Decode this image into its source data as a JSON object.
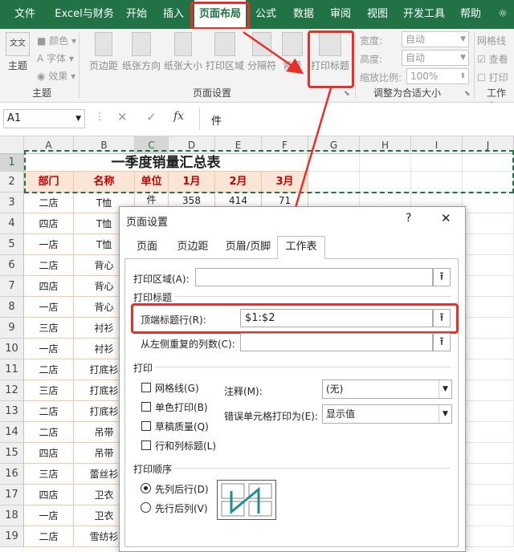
{
  "tabs": [
    "文件",
    "Excel与财务",
    "开始",
    "插入",
    "页面布局",
    "公式",
    "数据",
    "审阅",
    "视图",
    "开发工具",
    "帮助"
  ],
  "ribbon": {
    "theme_group": {
      "label": "主题",
      "themes": "主题",
      "colors": "颜色",
      "fonts": "字体",
      "effects": "效果"
    },
    "page_setup_group": {
      "label": "页面设置",
      "margins": "页边距",
      "orientation": "纸张方向",
      "size": "纸张大小",
      "print_area": "打印区域",
      "breaks": "分隔符",
      "background": "背景",
      "print_titles": "打印标题"
    },
    "scale_group": {
      "label": "调整为合适大小",
      "width_label": "宽度:",
      "width_value": "自动",
      "height_label": "高度:",
      "height_value": "自动",
      "scale_label": "缩放比例:",
      "scale_value": "100%"
    },
    "sheet_options_group": {
      "label": "工作表",
      "gridlines": "网格线",
      "view": "查看",
      "print": "打印"
    }
  },
  "formula_bar": {
    "name_box": "A1",
    "fx": "fx",
    "content": "件"
  },
  "columns": [
    "A",
    "B",
    "C",
    "D",
    "E",
    "F",
    "G",
    "H",
    "I",
    "J"
  ],
  "rows": [
    "1",
    "2",
    "3",
    "4",
    "5",
    "6",
    "7",
    "8",
    "9",
    "10",
    "11",
    "12",
    "13",
    "14",
    "15",
    "16",
    "17",
    "18",
    "19"
  ],
  "sheet": {
    "title": "一季度销量汇总表",
    "headers": [
      "部门",
      "名称",
      "单位",
      "1月",
      "2月",
      "3月"
    ],
    "row3_values": [
      "358",
      "414",
      "71"
    ],
    "dept": [
      "二店",
      "四店",
      "一店",
      "二店",
      "四店",
      "一店",
      "三店",
      "一店",
      "二店",
      "三店",
      "二店",
      "二店",
      "四店",
      "三店",
      "四店",
      "一店",
      "二店"
    ],
    "names": [
      "T恤",
      "T恤",
      "T恤",
      "背心",
      "背心",
      "背心",
      "衬衫",
      "衬衫",
      "打底衫",
      "打底衫",
      "打底衫",
      "吊带",
      "吊带",
      "蕾丝衫",
      "卫衣",
      "卫衣",
      "雪纺衫"
    ],
    "unit_first": "件"
  },
  "dialog": {
    "title": "页面设置",
    "help": "?",
    "close": "✕",
    "tabs": [
      "页面",
      "页边距",
      "页眉/页脚",
      "工作表"
    ],
    "print_area_label": "打印区域(A):",
    "print_titles_section": "打印标题",
    "rows_to_repeat_label": "顶端标题行(R):",
    "rows_to_repeat_value": "$1:$2",
    "cols_to_repeat_label": "从左侧重复的列数(C):",
    "print_section": "打印",
    "gridlines": "网格线(G)",
    "black_white": "单色打印(B)",
    "draft": "草稿质量(Q)",
    "row_col_headings": "行和列标题(L)",
    "comments_label": "注释(M):",
    "comments_value": "(无)",
    "errors_label": "错误单元格打印为(E):",
    "errors_value": "显示值",
    "order_section": "打印顺序",
    "down_then_over": "先列后行(D)",
    "over_then_down": "先行后列(V)",
    "collapse_icon": "⭱"
  },
  "colors": {
    "excel_green": "#217346",
    "highlight_red": "#e8302a",
    "header_fill": "#fbe5d6",
    "header_text": "#c00000"
  }
}
